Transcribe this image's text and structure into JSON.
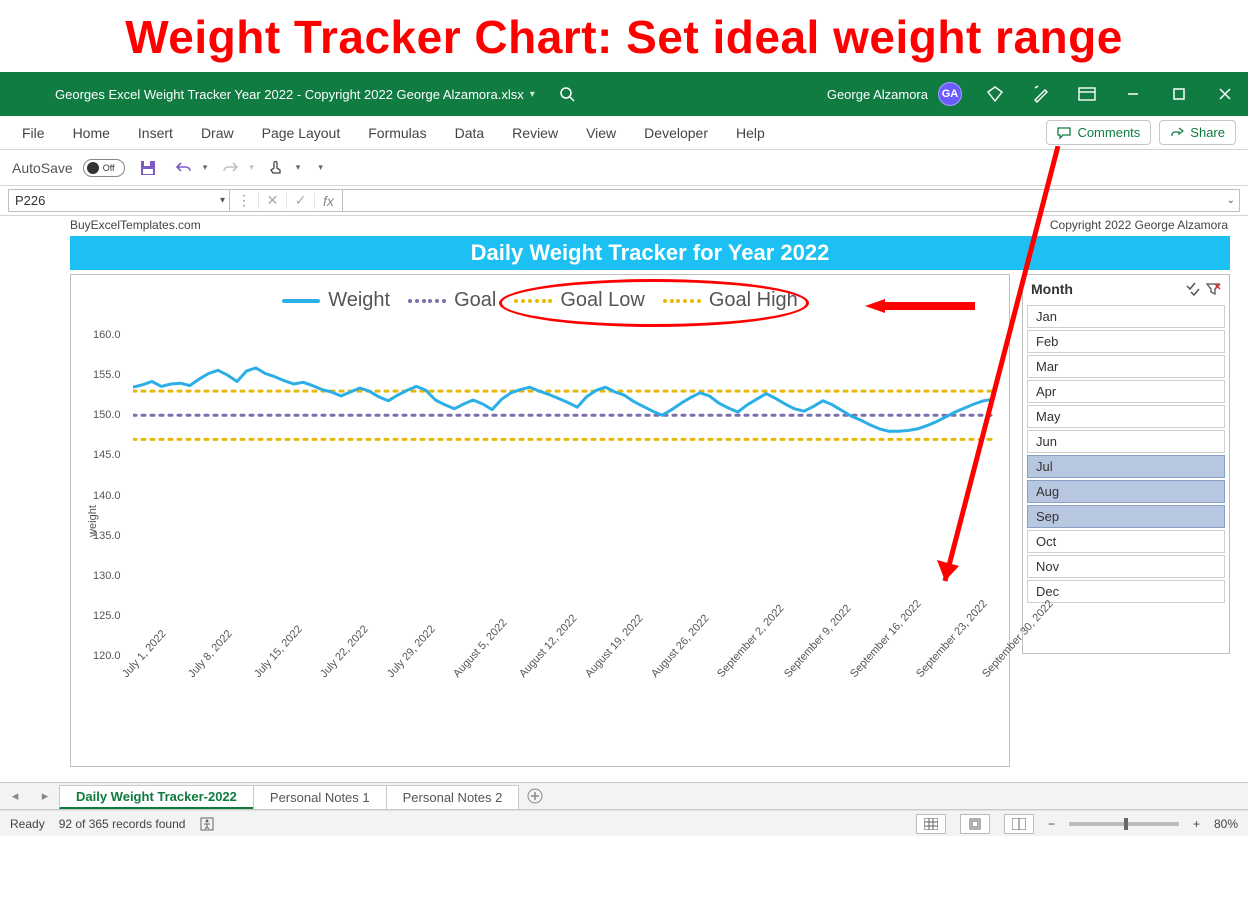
{
  "annotation_title": "Weight Tracker Chart: Set ideal weight range",
  "titlebar": {
    "filename": "Georges Excel Weight Tracker Year 2022 - Copyright 2022 George Alzamora.xlsx",
    "user_name": "George Alzamora",
    "user_initials": "GA"
  },
  "ribbon_tabs": [
    "File",
    "Home",
    "Insert",
    "Draw",
    "Page Layout",
    "Formulas",
    "Data",
    "Review",
    "View",
    "Developer",
    "Help"
  ],
  "ribbon_right": {
    "comments": "Comments",
    "share": "Share"
  },
  "qat": {
    "autosave_label": "AutoSave",
    "toggle_text": "Off"
  },
  "fxrow": {
    "namebox": "P226",
    "fx_label": "fx",
    "formula": ""
  },
  "sheet_header": {
    "left": "BuyExcelTemplates.com",
    "right": "Copyright 2022  George Alzamora"
  },
  "chart_title": "Daily Weight Tracker for Year 2022",
  "legend": {
    "weight": "Weight",
    "goal": "Goal",
    "goal_low": "Goal Low",
    "goal_high": "Goal High"
  },
  "y_axis_label": "weight",
  "slicer": {
    "header": "Month",
    "items": [
      "Jan",
      "Feb",
      "Mar",
      "Apr",
      "May",
      "Jun",
      "Jul",
      "Aug",
      "Sep",
      "Oct",
      "Nov",
      "Dec"
    ],
    "selected": [
      "Jul",
      "Aug",
      "Sep"
    ]
  },
  "sheet_tabs": [
    "Daily Weight Tracker-2022",
    "Personal Notes 1",
    "Personal Notes 2"
  ],
  "active_sheet_tab": 0,
  "statusbar": {
    "ready": "Ready",
    "records": "92 of 365 records found",
    "zoom": "80%"
  },
  "colors": {
    "excel_green": "#107c41",
    "chart_title_bg": "#1cc0f3",
    "weight_line": "#2caee6",
    "goal_line": "#7c6fb0",
    "goal_band": "#e6b800",
    "annotation_red": "#ff0000",
    "slicer_selected": "#b8c7e0"
  },
  "chart_data": {
    "type": "line",
    "title": "Daily Weight Tracker for Year 2022",
    "xlabel": "",
    "ylabel": "weight",
    "ylim": [
      120,
      160
    ],
    "y_ticks": [
      120.0,
      125.0,
      130.0,
      135.0,
      140.0,
      145.0,
      150.0,
      155.0,
      160.0
    ],
    "x_tick_labels": [
      "July 1, 2022",
      "July 8, 2022",
      "July 15, 2022",
      "July 22, 2022",
      "July 29, 2022",
      "August 5, 2022",
      "August 12, 2022",
      "August 19, 2022",
      "August 26, 2022",
      "September 2, 2022",
      "September 9, 2022",
      "September 16, 2022",
      "September 23, 2022",
      "September 30, 2022"
    ],
    "series": [
      {
        "name": "Goal",
        "style": "dotted",
        "color": "#7c6fb0",
        "constant": 150
      },
      {
        "name": "Goal Low",
        "style": "dotted",
        "color": "#e6b800",
        "constant": 147
      },
      {
        "name": "Goal High",
        "style": "dotted",
        "color": "#e6b800",
        "constant": 153
      },
      {
        "name": "Weight",
        "style": "solid",
        "color": "#2caee6",
        "values": [
          153.5,
          153.8,
          154.2,
          153.6,
          153.9,
          154.0,
          153.7,
          154.5,
          155.2,
          155.6,
          155.0,
          154.2,
          155.5,
          155.9,
          155.2,
          154.8,
          154.3,
          153.9,
          154.1,
          153.7,
          153.2,
          152.9,
          152.4,
          152.9,
          153.4,
          153.0,
          152.3,
          151.8,
          152.5,
          153.1,
          153.6,
          153.1,
          151.9,
          151.3,
          150.8,
          151.4,
          151.9,
          151.4,
          150.7,
          152.0,
          152.8,
          153.2,
          153.5,
          153.0,
          152.6,
          152.1,
          151.6,
          151.0,
          152.3,
          153.1,
          153.5,
          152.9,
          152.5,
          151.7,
          151.1,
          150.5,
          150.0,
          150.7,
          151.5,
          152.2,
          152.8,
          152.4,
          151.5,
          150.9,
          150.4,
          151.3,
          152.0,
          152.7,
          152.1,
          151.4,
          150.8,
          150.5,
          151.1,
          151.8,
          151.3,
          150.6,
          149.9,
          149.4,
          148.8,
          148.3,
          148.0,
          148.0,
          148.1,
          148.3,
          148.7,
          149.2,
          149.8,
          150.4,
          150.9,
          151.4,
          151.8,
          152.0
        ]
      }
    ],
    "x_count": 92
  }
}
